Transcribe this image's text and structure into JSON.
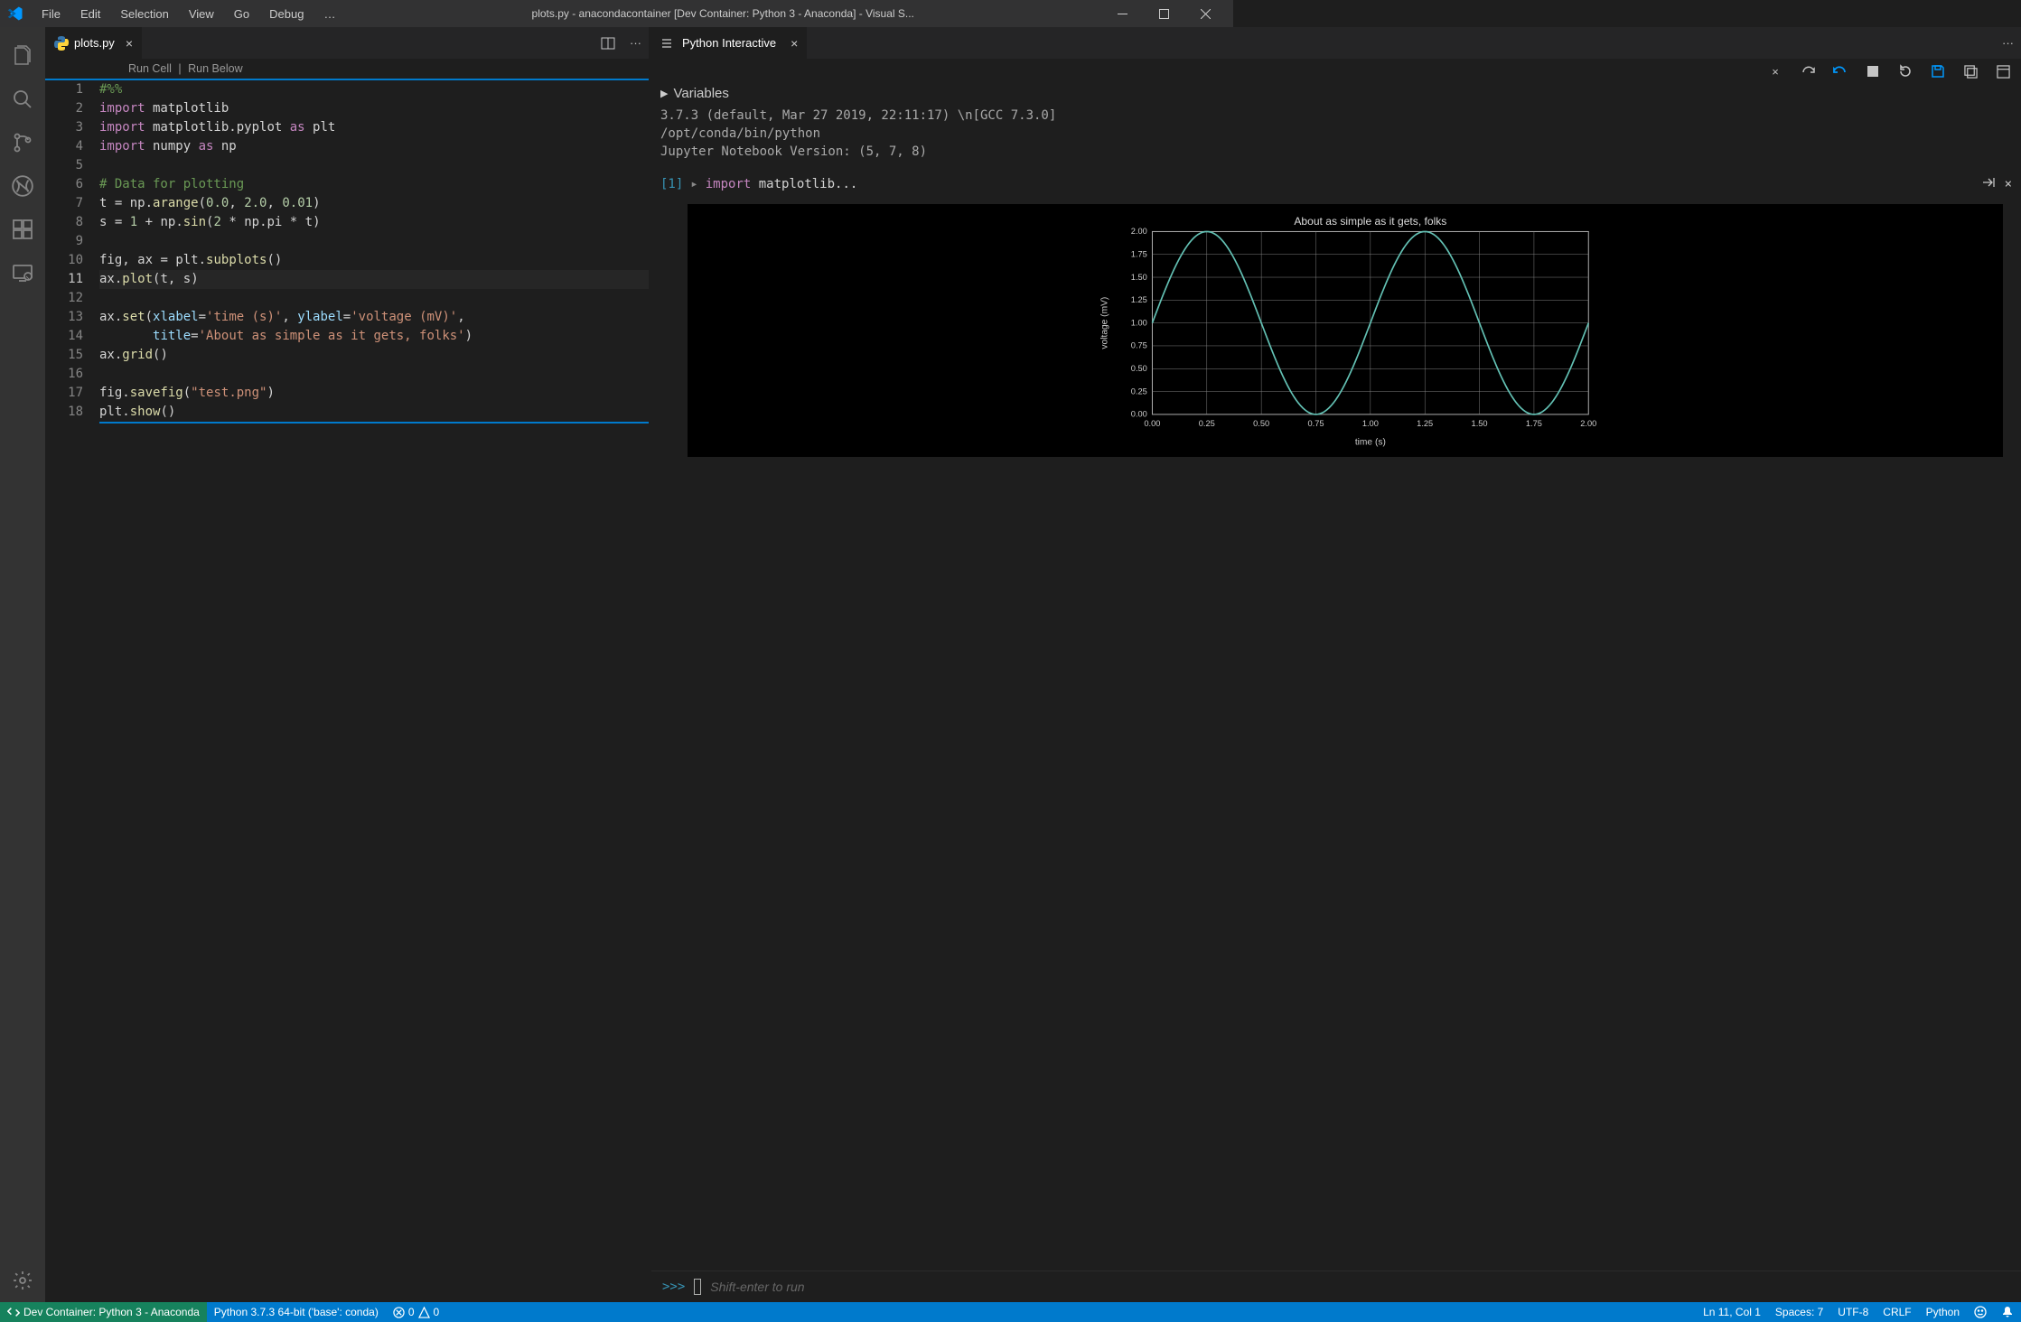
{
  "menu": [
    "File",
    "Edit",
    "Selection",
    "View",
    "Go",
    "Debug",
    "…"
  ],
  "window_title": "plots.py - anacondacontainer [Dev Container: Python 3 - Anaconda] - Visual S...",
  "tab_name": "plots.py",
  "codelens": {
    "run_cell": "Run Cell",
    "run_below": "Run Below"
  },
  "code_lines": [
    {
      "n": 1,
      "seg": [
        [
          "cmt",
          "#%%"
        ]
      ]
    },
    {
      "n": 2,
      "seg": [
        [
          "kw",
          "import"
        ],
        [
          "id",
          " matplotlib"
        ]
      ]
    },
    {
      "n": 3,
      "seg": [
        [
          "kw",
          "import"
        ],
        [
          "id",
          " matplotlib.pyplot "
        ],
        [
          "kw",
          "as"
        ],
        [
          "id",
          " plt"
        ]
      ]
    },
    {
      "n": 4,
      "seg": [
        [
          "kw",
          "import"
        ],
        [
          "id",
          " numpy "
        ],
        [
          "kw",
          "as"
        ],
        [
          "id",
          " np"
        ]
      ]
    },
    {
      "n": 5,
      "seg": []
    },
    {
      "n": 6,
      "seg": [
        [
          "cmt",
          "# Data for plotting"
        ]
      ]
    },
    {
      "n": 7,
      "seg": [
        [
          "id",
          "t "
        ],
        [
          "op",
          "="
        ],
        [
          "id",
          " np."
        ],
        [
          "func",
          "arange"
        ],
        [
          "op",
          "("
        ],
        [
          "num",
          "0.0"
        ],
        [
          "op",
          ", "
        ],
        [
          "num",
          "2.0"
        ],
        [
          "op",
          ", "
        ],
        [
          "num",
          "0.01"
        ],
        [
          "op",
          ")"
        ]
      ]
    },
    {
      "n": 8,
      "seg": [
        [
          "id",
          "s "
        ],
        [
          "op",
          "="
        ],
        [
          "num",
          " 1 "
        ],
        [
          "op",
          "+"
        ],
        [
          "id",
          " np."
        ],
        [
          "func",
          "sin"
        ],
        [
          "op",
          "("
        ],
        [
          "num",
          "2"
        ],
        [
          "op",
          " * "
        ],
        [
          "id",
          "np.pi"
        ],
        [
          "op",
          " * "
        ],
        [
          "id",
          "t"
        ],
        [
          "op",
          ")"
        ]
      ]
    },
    {
      "n": 9,
      "seg": []
    },
    {
      "n": 10,
      "seg": [
        [
          "id",
          "fig"
        ],
        [
          "op",
          ", "
        ],
        [
          "id",
          "ax"
        ],
        [
          "op",
          " = "
        ],
        [
          "id",
          "plt."
        ],
        [
          "func",
          "subplots"
        ],
        [
          "op",
          "()"
        ]
      ]
    },
    {
      "n": 11,
      "cur": true,
      "seg": [
        [
          "id",
          "ax."
        ],
        [
          "func",
          "plot"
        ],
        [
          "op",
          "("
        ],
        [
          "id",
          "t"
        ],
        [
          "op",
          ", "
        ],
        [
          "id",
          "s"
        ],
        [
          "op",
          ")"
        ]
      ]
    },
    {
      "n": 12,
      "seg": []
    },
    {
      "n": 13,
      "seg": [
        [
          "id",
          "ax."
        ],
        [
          "func",
          "set"
        ],
        [
          "op",
          "("
        ],
        [
          "name",
          "xlabel"
        ],
        [
          "op",
          "="
        ],
        [
          "str",
          "'time (s)'"
        ],
        [
          "op",
          ", "
        ],
        [
          "name",
          "ylabel"
        ],
        [
          "op",
          "="
        ],
        [
          "str",
          "'voltage (mV)'"
        ],
        [
          "op",
          ","
        ]
      ]
    },
    {
      "n": 14,
      "seg": [
        [
          "id",
          "       "
        ],
        [
          "name",
          "title"
        ],
        [
          "op",
          "="
        ],
        [
          "str",
          "'About as simple as it gets, folks'"
        ],
        [
          "op",
          ")"
        ]
      ]
    },
    {
      "n": 15,
      "seg": [
        [
          "id",
          "ax."
        ],
        [
          "func",
          "grid"
        ],
        [
          "op",
          "()"
        ]
      ]
    },
    {
      "n": 16,
      "seg": []
    },
    {
      "n": 17,
      "seg": [
        [
          "id",
          "fig."
        ],
        [
          "func",
          "savefig"
        ],
        [
          "op",
          "("
        ],
        [
          "str",
          "\"test.png\""
        ],
        [
          "op",
          ")"
        ]
      ]
    },
    {
      "n": 18,
      "seg": [
        [
          "id",
          "plt."
        ],
        [
          "func",
          "show"
        ],
        [
          "op",
          "()"
        ]
      ]
    }
  ],
  "interactive": {
    "title": "Python Interactive",
    "variables_label": "Variables",
    "info": "3.7.3 (default, Mar 27 2019, 22:11:17) \\n[GCC 7.3.0]\n/opt/conda/bin/python\nJupyter Notebook Version: (5, 7, 8)",
    "cell_label": "[1]",
    "cell_code_kw": "import",
    "cell_code_rest": " matplotlib...",
    "repl_prompt": ">>>",
    "repl_placeholder": "Shift-enter to run"
  },
  "chart_data": {
    "type": "line",
    "title": "About as simple as it gets, folks",
    "xlabel": "time (s)",
    "ylabel": "voltage (mV)",
    "xlim": [
      0.0,
      2.0
    ],
    "ylim": [
      0.0,
      2.0
    ],
    "xticks": [
      0.0,
      0.25,
      0.5,
      0.75,
      1.0,
      1.25,
      1.5,
      1.75,
      2.0
    ],
    "yticks": [
      0.0,
      0.25,
      0.5,
      0.75,
      1.0,
      1.25,
      1.5,
      1.75,
      2.0
    ],
    "equation": "s = 1 + sin(2*pi*t), t in [0, 2.0] step 0.01",
    "line_color": "#63c1b4",
    "grid": true
  },
  "status": {
    "remote": "Dev Container: Python 3 - Anaconda",
    "python": "Python 3.7.3 64-bit ('base': conda)",
    "errors": "0",
    "warnings": "0",
    "lncol": "Ln 11, Col 1",
    "spaces": "Spaces: 7",
    "encoding": "UTF-8",
    "eol": "CRLF",
    "lang": "Python"
  }
}
